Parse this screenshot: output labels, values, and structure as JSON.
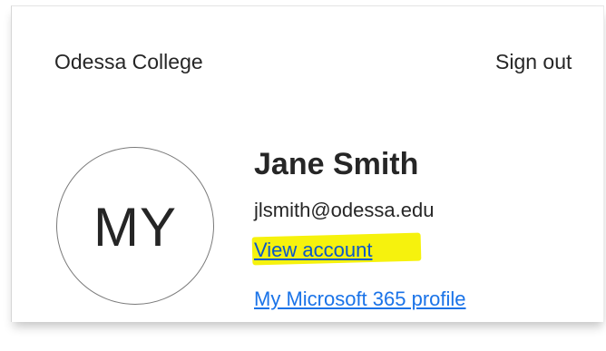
{
  "header": {
    "organization": "Odessa College",
    "sign_out_label": "Sign out"
  },
  "profile": {
    "avatar_initials": "MY",
    "name": "Jane Smith",
    "email": "jlsmith@odessa.edu",
    "view_account_label": "View account",
    "m365_profile_label": "My Microsoft 365 profile"
  },
  "colors": {
    "link": "#1a73e8",
    "highlight": "#f6f20d",
    "text": "#262626"
  }
}
